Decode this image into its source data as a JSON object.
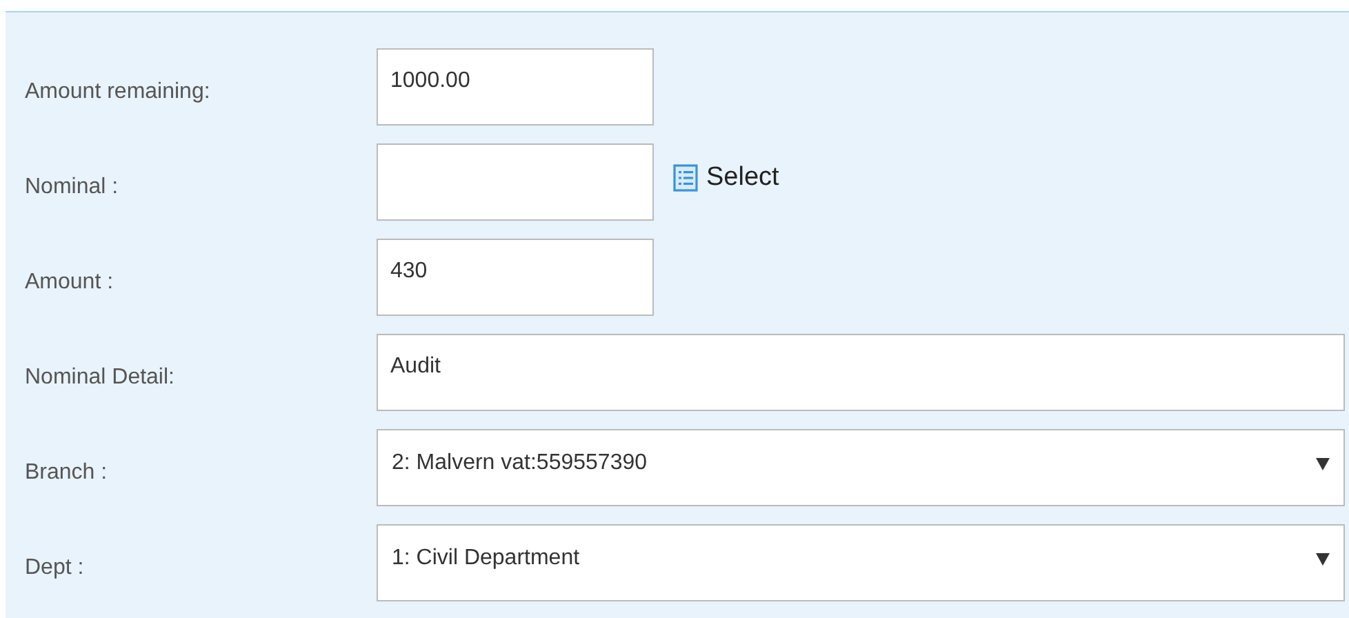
{
  "form": {
    "rows": [
      {
        "kind": "short",
        "label": "Amount remaining:",
        "value": "1000.00"
      },
      {
        "kind": "lookup",
        "label": "Nominal :",
        "value": "",
        "action": "Select"
      },
      {
        "kind": "short",
        "label": "Amount :",
        "value": "430"
      },
      {
        "kind": "wide",
        "label": "Nominal Detail:",
        "value": "Audit"
      },
      {
        "kind": "dropdown",
        "label": "Branch :",
        "value": "2: Malvern vat:559557390"
      },
      {
        "kind": "dropdown",
        "label": "Dept :",
        "value": "1: Civil Department"
      }
    ]
  }
}
